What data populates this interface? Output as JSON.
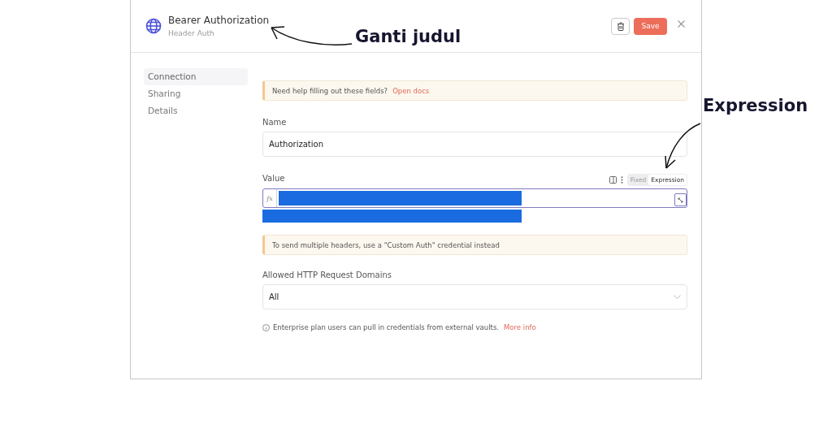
{
  "dialog": {
    "title": "Bearer Authorization",
    "subtitle": "Header Auth",
    "save_button": "Save"
  },
  "sidebar": {
    "items": [
      {
        "label": "Connection",
        "selected": true
      },
      {
        "label": "Sharing",
        "selected": false
      },
      {
        "label": "Details",
        "selected": false
      }
    ]
  },
  "help_note": {
    "text": "Need help filling out these fields?",
    "link": "Open docs"
  },
  "fields": [
    {
      "kind": "text",
      "label": "Name",
      "value": "Authorization"
    },
    {
      "kind": "expression",
      "label": "Value",
      "prefix": "fx",
      "modes": [
        {
          "label": "Fixed",
          "selected": false
        },
        {
          "label": "Expression",
          "selected": true
        }
      ]
    },
    {
      "kind": "note",
      "text": "To send multiple headers, use a \"Custom Auth\" credential instead"
    },
    {
      "kind": "select",
      "label": "Allowed HTTP Request Domains",
      "value": "All"
    }
  ],
  "footer_info": {
    "text": "Enterprise plan users can pull in credentials from external vaults.",
    "link": "More info"
  },
  "annotations": [
    {
      "text": "Ganti judul"
    },
    {
      "text": "Expression"
    }
  ]
}
